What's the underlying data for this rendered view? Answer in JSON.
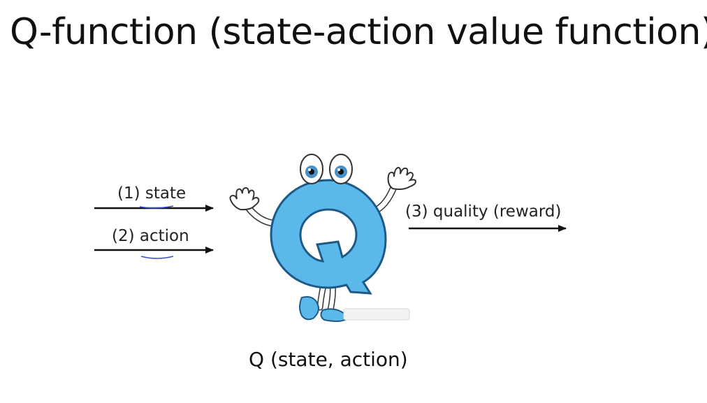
{
  "title": "Q-function (state-action value function)",
  "inputs": [
    {
      "label": "(1) state"
    },
    {
      "label": "(2) action"
    }
  ],
  "output": {
    "label": "(3) quality (reward)"
  },
  "caption": "Q (state, action)",
  "character": {
    "letter": "Q",
    "color": "#5bb8ea"
  }
}
